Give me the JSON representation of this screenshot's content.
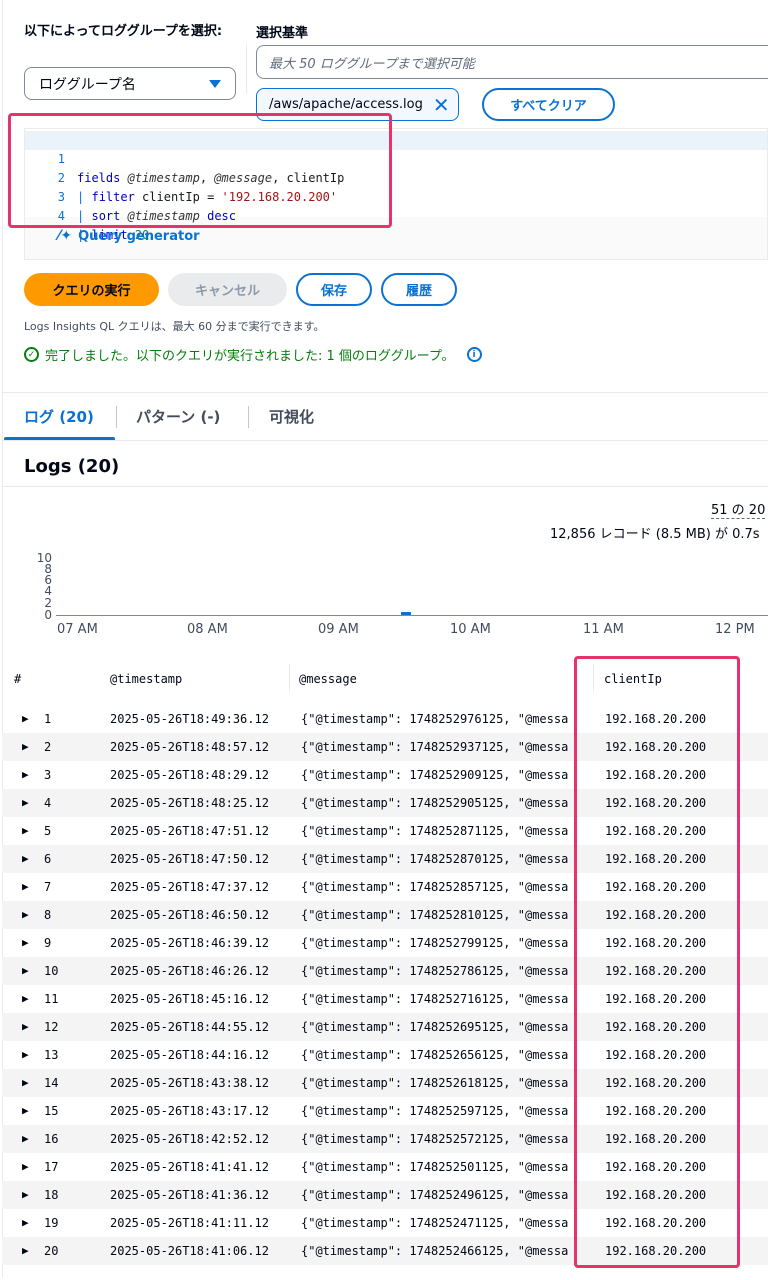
{
  "selector": {
    "label": "以下によってロググループを選択:",
    "dropdown_value": "ロググループ名",
    "criteria_label": "選択基準",
    "criteria_placeholder": "最大 50 ロググループまで選択可能",
    "selected_token": "/aws/apache/access.log",
    "clear_all_label": "すべてクリア"
  },
  "editor": {
    "line_numbers": [
      "1",
      "2",
      "3",
      "4"
    ],
    "line1": {
      "kw": "fields",
      "f1": "@timestamp",
      "sep1": ", ",
      "f2": "@message",
      "rest": ", clientIp"
    },
    "line2": {
      "pipe": "|",
      "kw": "filter",
      "rest": " clientIp = ",
      "str": "'192.168.20.200'"
    },
    "line3": {
      "pipe": "|",
      "kw": "sort",
      "f": "@timestamp",
      "kw2": "desc"
    },
    "line4": {
      "pipe": "|",
      "kw": "limit",
      "num": "20"
    },
    "query_generator_label": "Query generator"
  },
  "actions": {
    "run_label": "クエリの実行",
    "cancel_label": "キャンセル",
    "save_label": "保存",
    "history_label": "履歴",
    "hint": "Logs Insights QL クエリは、最大 60 分まで実行できます。",
    "status": "完了しました。以下のクエリが実行されました: 1 個のロググループ。"
  },
  "tabs": [
    {
      "label": "ログ (20)"
    },
    {
      "label": "パターン (-)"
    },
    {
      "label": "可視化"
    }
  ],
  "logs_title": "Logs (20)",
  "summary": {
    "matched": "51 の 20",
    "records": "12,856 レコード (8.5 MB) が 0.7s"
  },
  "histogram": {
    "y_ticks": [
      "10",
      "8",
      "6",
      "4",
      "2",
      "0"
    ],
    "x_ticks": [
      "07 AM",
      "08 AM",
      "09 AM",
      "10 AM",
      "11 AM",
      "12 PM"
    ],
    "bucket_label": "09:30",
    "bucket_count": 1
  },
  "table": {
    "headers": [
      "#",
      "@timestamp",
      "@message",
      "clientIp"
    ],
    "rows": [
      {
        "n": "1",
        "ts": "2025-05-26T18:49:36.12",
        "msg": "{\"@timestamp\": 1748252976125, \"@messa",
        "ip": "192.168.20.200"
      },
      {
        "n": "2",
        "ts": "2025-05-26T18:48:57.12",
        "msg": "{\"@timestamp\": 1748252937125, \"@messa",
        "ip": "192.168.20.200"
      },
      {
        "n": "3",
        "ts": "2025-05-26T18:48:29.12",
        "msg": "{\"@timestamp\": 1748252909125, \"@messa",
        "ip": "192.168.20.200"
      },
      {
        "n": "4",
        "ts": "2025-05-26T18:48:25.12",
        "msg": "{\"@timestamp\": 1748252905125, \"@messa",
        "ip": "192.168.20.200"
      },
      {
        "n": "5",
        "ts": "2025-05-26T18:47:51.12",
        "msg": "{\"@timestamp\": 1748252871125, \"@messa",
        "ip": "192.168.20.200"
      },
      {
        "n": "6",
        "ts": "2025-05-26T18:47:50.12",
        "msg": "{\"@timestamp\": 1748252870125, \"@messa",
        "ip": "192.168.20.200"
      },
      {
        "n": "7",
        "ts": "2025-05-26T18:47:37.12",
        "msg": "{\"@timestamp\": 1748252857125, \"@messa",
        "ip": "192.168.20.200"
      },
      {
        "n": "8",
        "ts": "2025-05-26T18:46:50.12",
        "msg": "{\"@timestamp\": 1748252810125, \"@messa",
        "ip": "192.168.20.200"
      },
      {
        "n": "9",
        "ts": "2025-05-26T18:46:39.12",
        "msg": "{\"@timestamp\": 1748252799125, \"@messa",
        "ip": "192.168.20.200"
      },
      {
        "n": "10",
        "ts": "2025-05-26T18:46:26.12",
        "msg": "{\"@timestamp\": 1748252786125, \"@messa",
        "ip": "192.168.20.200"
      },
      {
        "n": "11",
        "ts": "2025-05-26T18:45:16.12",
        "msg": "{\"@timestamp\": 1748252716125, \"@messa",
        "ip": "192.168.20.200"
      },
      {
        "n": "12",
        "ts": "2025-05-26T18:44:55.12",
        "msg": "{\"@timestamp\": 1748252695125, \"@messa",
        "ip": "192.168.20.200"
      },
      {
        "n": "13",
        "ts": "2025-05-26T18:44:16.12",
        "msg": "{\"@timestamp\": 1748252656125, \"@messa",
        "ip": "192.168.20.200"
      },
      {
        "n": "14",
        "ts": "2025-05-26T18:43:38.12",
        "msg": "{\"@timestamp\": 1748252618125, \"@messa",
        "ip": "192.168.20.200"
      },
      {
        "n": "15",
        "ts": "2025-05-26T18:43:17.12",
        "msg": "{\"@timestamp\": 1748252597125, \"@messa",
        "ip": "192.168.20.200"
      },
      {
        "n": "16",
        "ts": "2025-05-26T18:42:52.12",
        "msg": "{\"@timestamp\": 1748252572125, \"@messa",
        "ip": "192.168.20.200"
      },
      {
        "n": "17",
        "ts": "2025-05-26T18:41:41.12",
        "msg": "{\"@timestamp\": 1748252501125, \"@messa",
        "ip": "192.168.20.200"
      },
      {
        "n": "18",
        "ts": "2025-05-26T18:41:36.12",
        "msg": "{\"@timestamp\": 1748252496125, \"@messa",
        "ip": "192.168.20.200"
      },
      {
        "n": "19",
        "ts": "2025-05-26T18:41:11.12",
        "msg": "{\"@timestamp\": 1748252471125, \"@messa",
        "ip": "192.168.20.200"
      },
      {
        "n": "20",
        "ts": "2025-05-26T18:41:06.12",
        "msg": "{\"@timestamp\": 1748252466125, \"@messa",
        "ip": "192.168.20.200"
      }
    ]
  },
  "colors": {
    "accent": "#0972d3",
    "primary_button": "#ff9900",
    "success": "#037f0c",
    "annotation": "#e6336b"
  },
  "icons": [
    "chevron-down-icon",
    "close-icon",
    "magic-wand-icon",
    "check-circle-icon",
    "info-icon",
    "expand-arrow-icon"
  ]
}
